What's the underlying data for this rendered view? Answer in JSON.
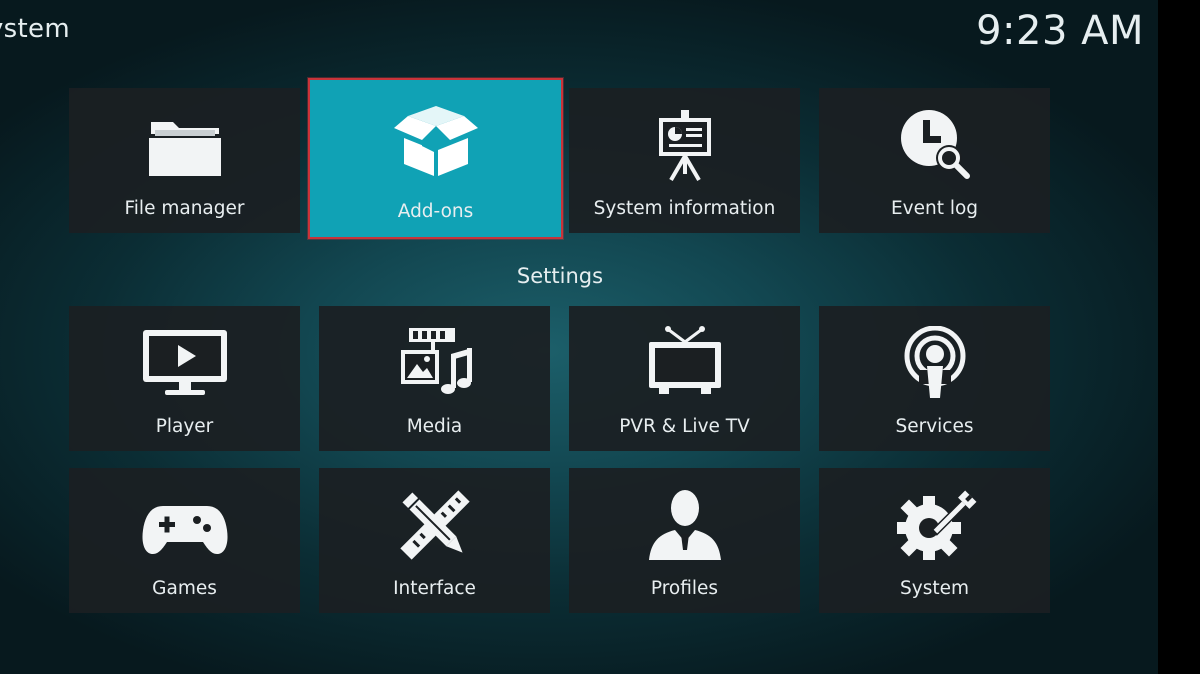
{
  "header": {
    "window_title": "ystem",
    "clock": "9:23 AM"
  },
  "top_row": [
    {
      "label": "File manager",
      "icon": "folder-icon"
    },
    {
      "label": "Add-ons",
      "icon": "open-box-icon",
      "focused": true
    },
    {
      "label": "System information",
      "icon": "presentation-board-icon"
    },
    {
      "label": "Event log",
      "icon": "clock-search-icon"
    }
  ],
  "settings": {
    "heading": "Settings",
    "tiles": [
      {
        "label": "Player",
        "icon": "monitor-play-icon"
      },
      {
        "label": "Media",
        "icon": "media-film-music-icon"
      },
      {
        "label": "PVR & Live TV",
        "icon": "tv-antenna-icon"
      },
      {
        "label": "Services",
        "icon": "broadcast-podcast-icon"
      },
      {
        "label": "Games",
        "icon": "gamepad-icon"
      },
      {
        "label": "Interface",
        "icon": "pencil-ruler-icon"
      },
      {
        "label": "Profiles",
        "icon": "person-silhouette-icon"
      },
      {
        "label": "System",
        "icon": "gear-wrench-icon"
      }
    ]
  },
  "colors": {
    "focus_fill": "#10a2b5",
    "focus_border": "#c8343a",
    "tile_fill": "#1b1f22",
    "text": "#e8eef0"
  }
}
